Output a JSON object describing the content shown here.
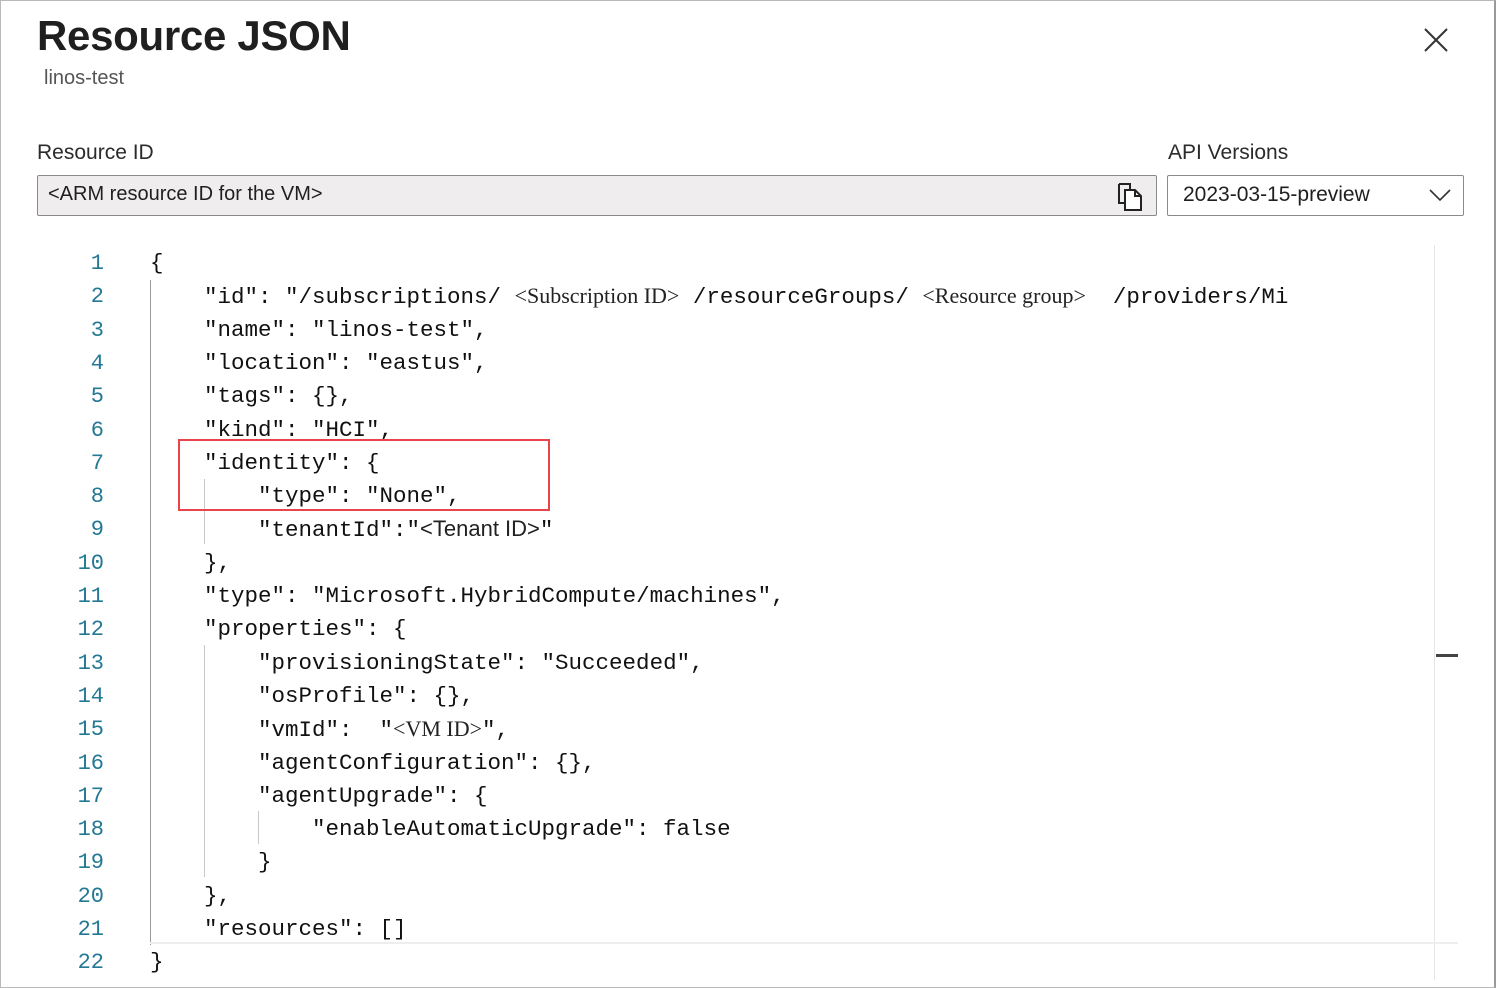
{
  "header": {
    "title": "Resource JSON",
    "subtitle": "linos-test",
    "close_icon": "close-icon"
  },
  "resource_id": {
    "label": "Resource ID",
    "value": "<ARM resource ID for the VM>",
    "copy_icon": "copy-icon"
  },
  "api_versions": {
    "label": "API Versions",
    "selected": "2023-03-15-preview"
  },
  "highlight_color": "#e8444a",
  "json_lines": [
    {
      "n": "1",
      "indent": 0,
      "segs": [
        {
          "t": "{"
        }
      ]
    },
    {
      "n": "2",
      "indent": 1,
      "segs": [
        {
          "t": "\"id\": \"/subscriptions/ "
        },
        {
          "t": "<Subscription ID>",
          "c": "ph"
        },
        {
          "t": " /resourceGroups/ "
        },
        {
          "t": "<Resource group>",
          "c": "ph"
        },
        {
          "t": "  /providers/Mi"
        }
      ]
    },
    {
      "n": "3",
      "indent": 1,
      "segs": [
        {
          "t": "\"name\": \"linos-test\","
        }
      ]
    },
    {
      "n": "4",
      "indent": 1,
      "segs": [
        {
          "t": "\"location\": \"eastus\","
        }
      ]
    },
    {
      "n": "5",
      "indent": 1,
      "segs": [
        {
          "t": "\"tags\": {},"
        }
      ]
    },
    {
      "n": "6",
      "indent": 1,
      "segs": [
        {
          "t": "\"kind\": \"HCI\","
        }
      ]
    },
    {
      "n": "7",
      "indent": 1,
      "segs": [
        {
          "t": "\"identity\": {"
        }
      ]
    },
    {
      "n": "8",
      "indent": 2,
      "segs": [
        {
          "t": "\"type\": \"None\","
        }
      ]
    },
    {
      "n": "9",
      "indent": 2,
      "segs": [
        {
          "t": "\"tenantId\":\""
        },
        {
          "t": "<Tenant ID>",
          "c": "phs"
        },
        {
          "t": "\""
        }
      ]
    },
    {
      "n": "10",
      "indent": 1,
      "segs": [
        {
          "t": "},"
        }
      ]
    },
    {
      "n": "11",
      "indent": 1,
      "segs": [
        {
          "t": "\"type\": \"Microsoft.HybridCompute/machines\","
        }
      ]
    },
    {
      "n": "12",
      "indent": 1,
      "segs": [
        {
          "t": "\"properties\": {"
        }
      ]
    },
    {
      "n": "13",
      "indent": 2,
      "segs": [
        {
          "t": "\"provisioningState\": \"Succeeded\","
        }
      ]
    },
    {
      "n": "14",
      "indent": 2,
      "segs": [
        {
          "t": "\"osProfile\": {},"
        }
      ]
    },
    {
      "n": "15",
      "indent": 2,
      "segs": [
        {
          "t": "\"vmId\":  \""
        },
        {
          "t": "<VM ID>",
          "c": "ph"
        },
        {
          "t": "\","
        }
      ]
    },
    {
      "n": "16",
      "indent": 2,
      "segs": [
        {
          "t": "\"agentConfiguration\": {},"
        }
      ]
    },
    {
      "n": "17",
      "indent": 2,
      "segs": [
        {
          "t": "\"agentUpgrade\": {"
        }
      ]
    },
    {
      "n": "18",
      "indent": 3,
      "segs": [
        {
          "t": "\"enableAutomaticUpgrade\": false"
        }
      ]
    },
    {
      "n": "19",
      "indent": 2,
      "segs": [
        {
          "t": "}"
        }
      ]
    },
    {
      "n": "20",
      "indent": 1,
      "segs": [
        {
          "t": "},"
        }
      ]
    },
    {
      "n": "21",
      "indent": 1,
      "segs": [
        {
          "t": "\"resources\": []"
        }
      ]
    },
    {
      "n": "22",
      "indent": 0,
      "segs": [
        {
          "t": "}"
        }
      ]
    }
  ]
}
